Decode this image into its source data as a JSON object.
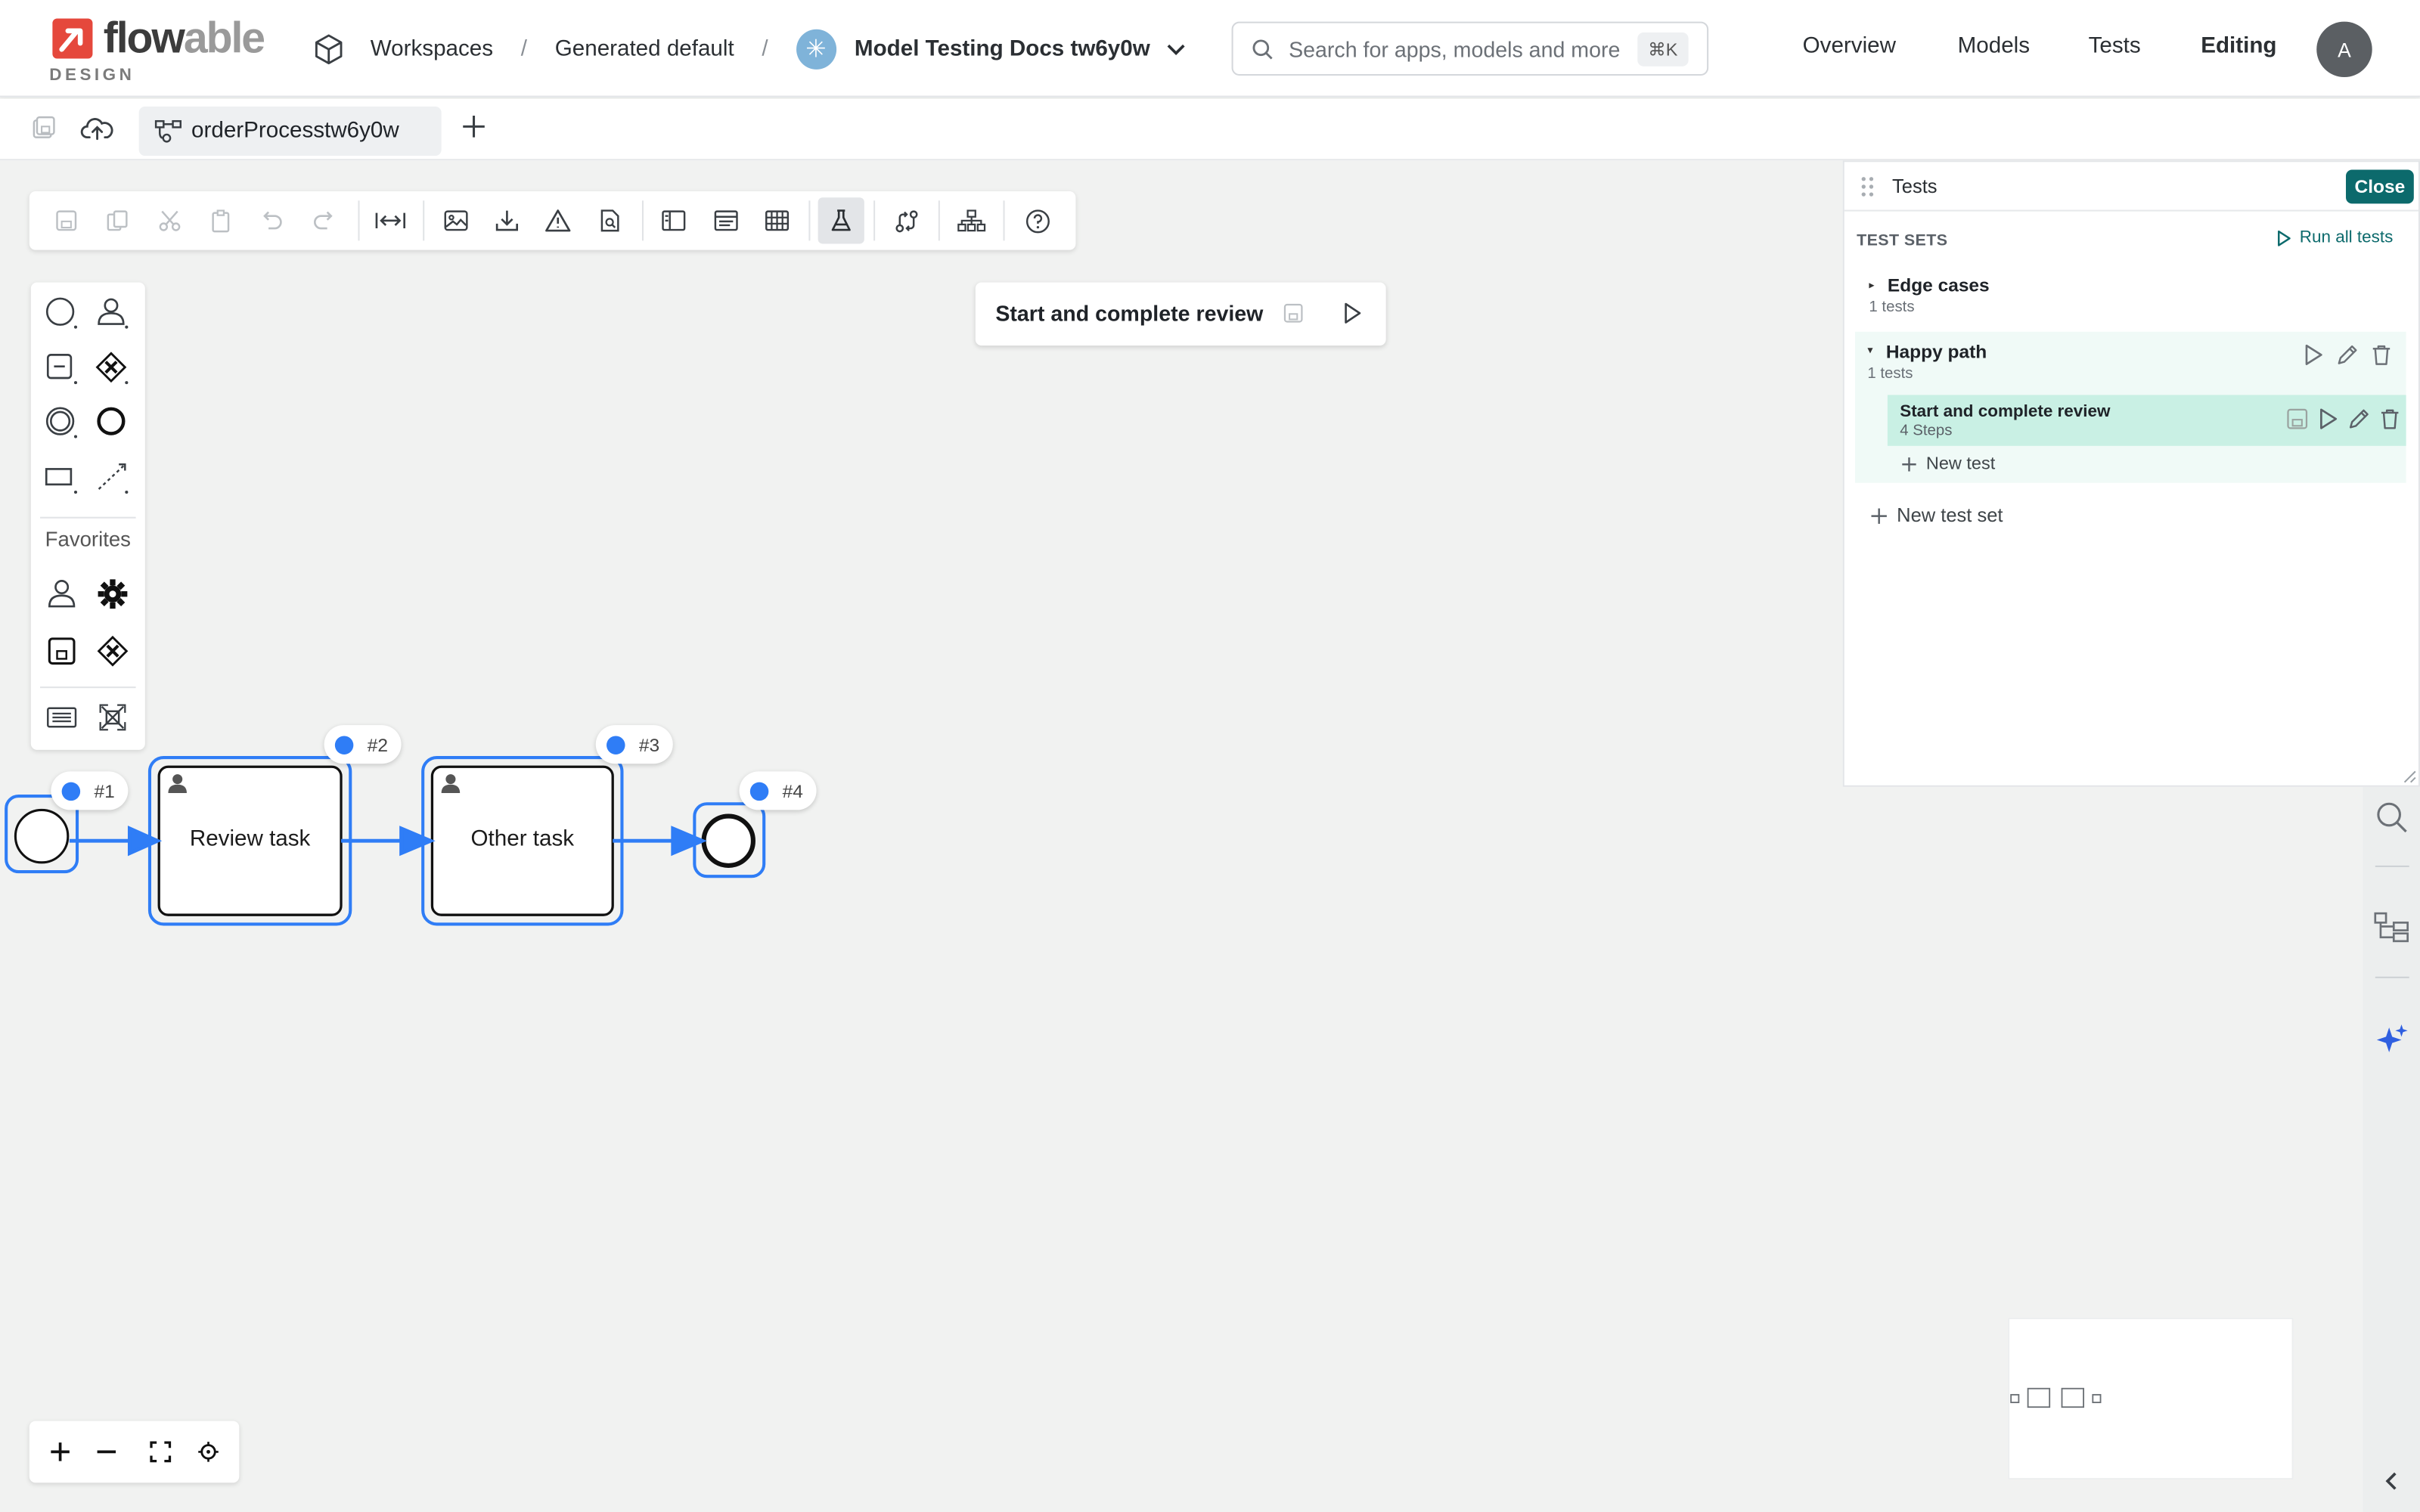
{
  "header": {
    "logo_word_a": "flow",
    "logo_word_b": "able",
    "logo_sub": "DESIGN",
    "breadcrumbs": [
      "Workspaces",
      "Generated default"
    ],
    "model_name": "Model Testing Docs tw6y0w",
    "search_placeholder": "Search for apps, models and more",
    "search_shortcut": "⌘K",
    "nav": [
      "Overview",
      "Models",
      "Tests",
      "Editing"
    ],
    "active_nav": "Editing",
    "avatar_initial": "A"
  },
  "tabs": {
    "file_tab_label": "orderProcesstw6y0w"
  },
  "palette": {
    "favorites_label": "Favorites"
  },
  "run_card": {
    "title": "Start and complete review"
  },
  "diagram": {
    "badges": [
      "#1",
      "#2",
      "#3",
      "#4"
    ],
    "tasks": [
      "Review task",
      "Other task"
    ],
    "accent": "#2f7df6"
  },
  "tests_panel": {
    "title": "Tests",
    "close_label": "Close",
    "section_title": "TEST SETS",
    "run_all_label": "Run all tests",
    "sets": [
      {
        "name": "Edge cases",
        "count": "1 tests",
        "expanded": false
      },
      {
        "name": "Happy path",
        "count": "1 tests",
        "expanded": true
      }
    ],
    "test": {
      "name": "Start and complete review",
      "steps": "4 Steps"
    },
    "new_test_label": "New test",
    "new_test_set_label": "New test set",
    "accent": "#0c6a6c"
  }
}
